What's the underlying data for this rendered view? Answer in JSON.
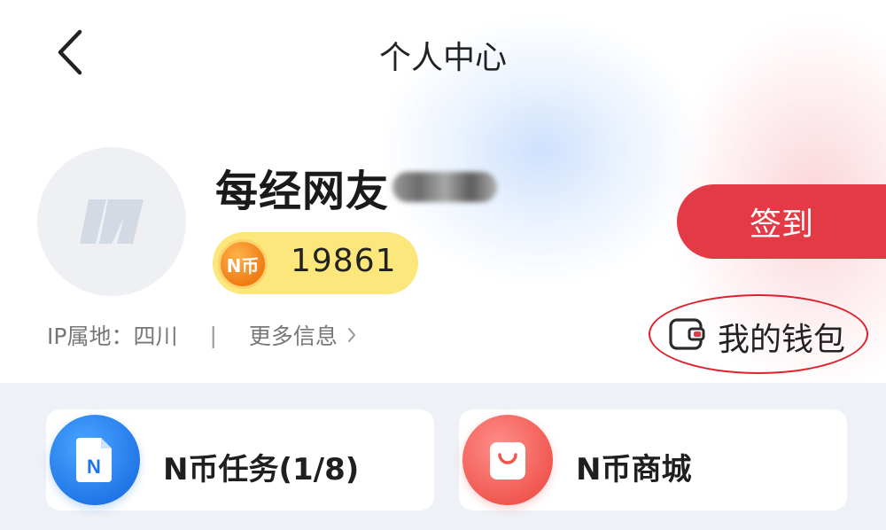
{
  "header": {
    "title": "个人中心",
    "back_icon": "chevron-left-icon"
  },
  "profile": {
    "username": "每经网友",
    "username_redacted": true,
    "avatar_icon": "brand-n-logo-icon",
    "coin_badge_label": "N币",
    "coin_balance": "19861",
    "ip_location": "IP属地：四川",
    "separator": "|",
    "more_info_label": "更多信息",
    "more_info_icon": "chevron-right-icon"
  },
  "actions": {
    "sign_in_label": "签到",
    "wallet_label": "我的钱包",
    "wallet_icon": "wallet-icon"
  },
  "cards": [
    {
      "label": "N币任务(1/8)",
      "icon": "document-n-icon",
      "color": "#1f74e6"
    },
    {
      "label": "N币商城",
      "icon": "shopping-bag-icon",
      "color": "#f0554e"
    }
  ],
  "colors": {
    "accent_red": "#e33a46",
    "coin_yellow": "#fbe77b",
    "highlight_ring": "#e0202a",
    "section_bg": "#eef1f6"
  }
}
